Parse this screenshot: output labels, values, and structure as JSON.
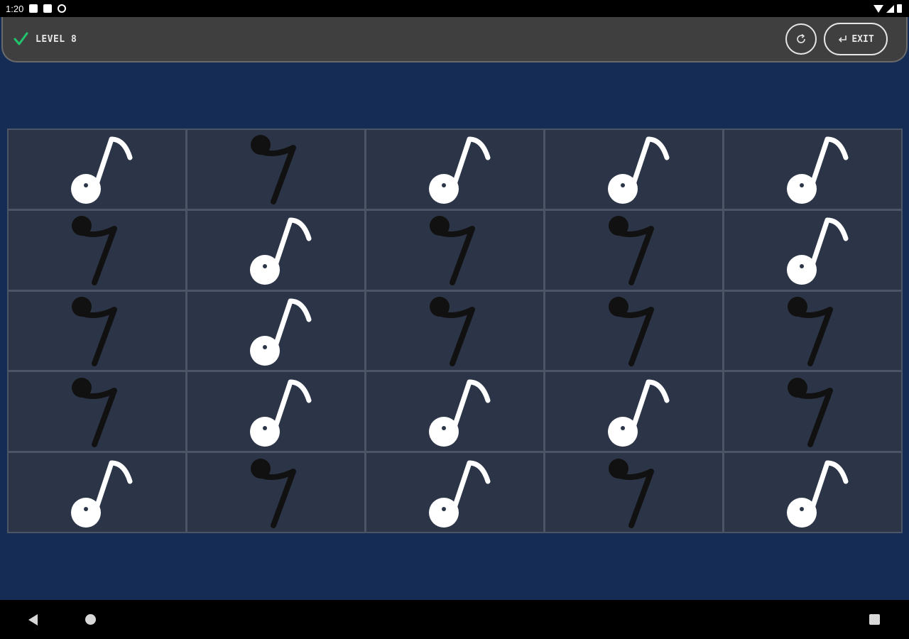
{
  "status_bar": {
    "time": "1:20",
    "icons": [
      "notification-icon",
      "sim-card-icon",
      "sync-icon",
      "wifi-icon",
      "cell-signal-icon",
      "battery-icon"
    ]
  },
  "top_bar": {
    "level_label": "LEVEL 8",
    "restart_icon": "refresh-icon",
    "exit_label": "EXIT",
    "check_color": "#21c46b"
  },
  "board": {
    "rows": [
      [
        "note",
        "rest",
        "note",
        "note",
        "note"
      ],
      [
        "rest",
        "note",
        "rest",
        "rest",
        "note"
      ],
      [
        "rest",
        "note",
        "rest",
        "rest",
        "rest"
      ],
      [
        "rest",
        "note",
        "note",
        "note",
        "rest"
      ],
      [
        "note",
        "rest",
        "note",
        "rest",
        "note"
      ]
    ],
    "symbols": {
      "note": "eighth-note-icon",
      "rest": "eighth-rest-icon"
    },
    "colors": {
      "note": "#ffffff",
      "rest": "#111111",
      "cell_bg": "#2c3548",
      "cell_border": "#4b5566"
    }
  },
  "nav_bar": {
    "buttons": [
      "back-icon",
      "home-icon",
      "recents-icon"
    ]
  }
}
